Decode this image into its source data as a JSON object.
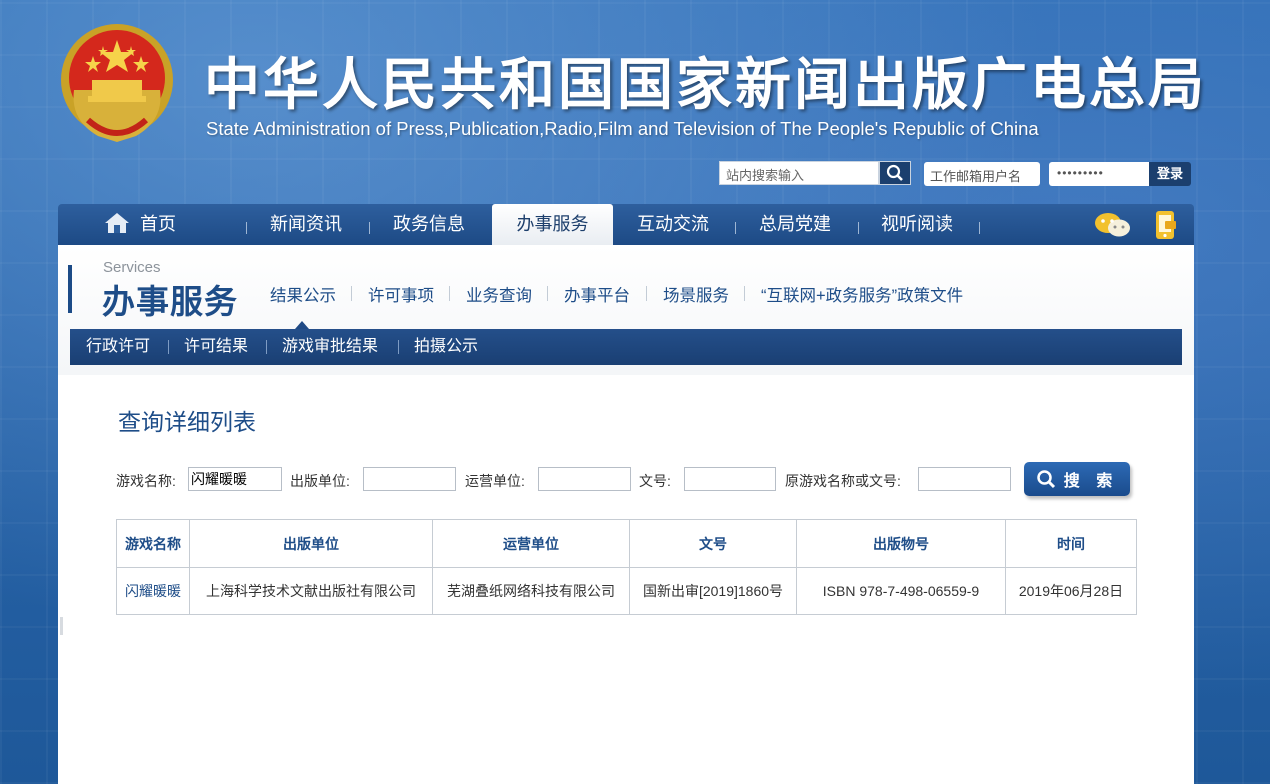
{
  "header": {
    "title_cn": "中华人民共和国国家新闻出版广电总局",
    "title_en": "State Administration of Press,Publication,Radio,Film and Television of The People's Republic of China",
    "search_placeholder": "站内搜索输入",
    "mail_user_placeholder": "工作邮箱用户名",
    "mail_password_mask": "•••••••••",
    "login_label": "登录"
  },
  "nav": {
    "home": "首页",
    "items": [
      "新闻资讯",
      "政务信息",
      "办事服务",
      "互动交流",
      "总局党建",
      "视听阅读"
    ],
    "active": "办事服务"
  },
  "section": {
    "en": "Services",
    "cn": "办事服务",
    "sub_links": [
      "结果公示",
      "许可事项",
      "业务查询",
      "办事平台",
      "场景服务",
      "“互联网+政务服务”政策文件"
    ],
    "bar_items": [
      "行政许可",
      "许可结果",
      "游戏审批结果",
      "拍摄公示"
    ]
  },
  "query": {
    "title": "查询详细列表",
    "labels": {
      "game_name": "游戏名称:",
      "publisher": "出版单位:",
      "operator": "运营单位:",
      "doc_no": "文号:",
      "orig": "原游戏名称或文号:"
    },
    "values": {
      "game_name": "闪耀暖暖",
      "publisher": "",
      "operator": "",
      "doc_no": "",
      "orig": ""
    },
    "search_label": "搜 索"
  },
  "table": {
    "headers": [
      "游戏名称",
      "出版单位",
      "运营单位",
      "文号",
      "出版物号",
      "时间"
    ],
    "rows": [
      [
        "闪耀暖暖",
        "上海科学技术文献出版社有限公司",
        "芜湖叠纸网络科技有限公司",
        "国新出审[2019]1860号",
        "ISBN 978-7-498-06559-9",
        "2019年06月28日"
      ]
    ]
  },
  "colors": {
    "brand_blue": "#1e4d88",
    "nav_blue": "#1d4a85",
    "background_blue": "#2a66ac"
  },
  "icons": [
    "national-emblem",
    "search-icon",
    "home-icon",
    "wechat-icon",
    "mobile-icon",
    "magnifier-icon"
  ]
}
